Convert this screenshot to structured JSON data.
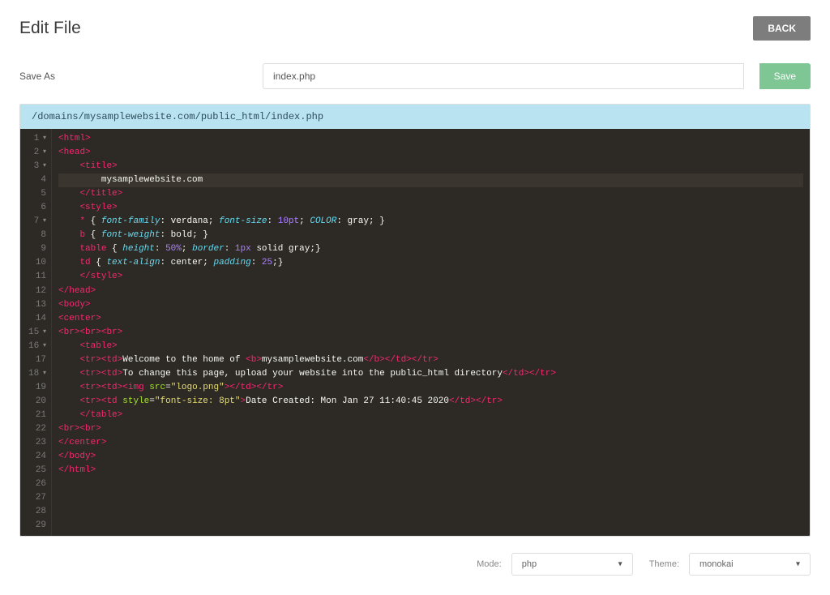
{
  "header": {
    "title": "Edit File",
    "back_label": "BACK"
  },
  "save": {
    "label": "Save As",
    "filename": "index.php",
    "save_label": "Save"
  },
  "path": "/domains/mysamplewebsite.com/public_html/index.php",
  "code_lines": [
    {
      "n": 1,
      "fold": true,
      "segs": [
        [
          "<",
          "t-tag"
        ],
        [
          "html",
          "t-tag"
        ],
        [
          ">",
          "t-tag"
        ]
      ]
    },
    {
      "n": 2,
      "fold": true,
      "segs": [
        [
          "<",
          "t-tag"
        ],
        [
          "head",
          "t-tag"
        ],
        [
          ">",
          "t-tag"
        ]
      ]
    },
    {
      "n": 3,
      "fold": true,
      "segs": [
        [
          "    ",
          "t-text"
        ],
        [
          "<",
          "t-tag"
        ],
        [
          "title",
          "t-tag"
        ],
        [
          ">",
          "t-tag"
        ]
      ]
    },
    {
      "n": 4,
      "active": true,
      "segs": [
        [
          "        mysamplewebsite.com",
          "t-text"
        ]
      ]
    },
    {
      "n": 5,
      "segs": [
        [
          "    ",
          "t-text"
        ],
        [
          "</",
          "t-tag"
        ],
        [
          "title",
          "t-tag"
        ],
        [
          ">",
          "t-tag"
        ]
      ]
    },
    {
      "n": 6,
      "segs": [
        [
          "",
          "t-text"
        ]
      ]
    },
    {
      "n": 7,
      "fold": true,
      "segs": [
        [
          "    ",
          "t-text"
        ],
        [
          "<",
          "t-tag"
        ],
        [
          "style",
          "t-tag"
        ],
        [
          ">",
          "t-tag"
        ]
      ]
    },
    {
      "n": 8,
      "segs": [
        [
          "    ",
          "t-text"
        ],
        [
          "*",
          "t-sel"
        ],
        [
          " { ",
          "t-brace"
        ],
        [
          "font-family",
          "t-kw"
        ],
        [
          ": verdana; ",
          "t-text"
        ],
        [
          "font-size",
          "t-kw"
        ],
        [
          ": ",
          "t-text"
        ],
        [
          "10pt",
          "t-num"
        ],
        [
          "; ",
          "t-text"
        ],
        [
          "COLOR",
          "t-kw"
        ],
        [
          ": gray; ",
          "t-text"
        ],
        [
          "}",
          "t-brace"
        ]
      ]
    },
    {
      "n": 9,
      "segs": [
        [
          "    ",
          "t-text"
        ],
        [
          "b",
          "t-sel"
        ],
        [
          " { ",
          "t-brace"
        ],
        [
          "font-weight",
          "t-kw"
        ],
        [
          ": bold; ",
          "t-text"
        ],
        [
          "}",
          "t-brace"
        ]
      ]
    },
    {
      "n": 10,
      "segs": [
        [
          "    ",
          "t-text"
        ],
        [
          "table",
          "t-sel"
        ],
        [
          " { ",
          "t-brace"
        ],
        [
          "height",
          "t-kw"
        ],
        [
          ": ",
          "t-text"
        ],
        [
          "50%",
          "t-num"
        ],
        [
          "; ",
          "t-text"
        ],
        [
          "border",
          "t-kw"
        ],
        [
          ": ",
          "t-text"
        ],
        [
          "1px",
          "t-num"
        ],
        [
          " solid gray;",
          "t-text"
        ],
        [
          "}",
          "t-brace"
        ]
      ]
    },
    {
      "n": 11,
      "segs": [
        [
          "    ",
          "t-text"
        ],
        [
          "td",
          "t-sel"
        ],
        [
          " { ",
          "t-brace"
        ],
        [
          "text-align",
          "t-kw"
        ],
        [
          ": center; ",
          "t-text"
        ],
        [
          "padding",
          "t-kw"
        ],
        [
          ": ",
          "t-text"
        ],
        [
          "25",
          "t-num"
        ],
        [
          ";",
          "t-text"
        ],
        [
          "}",
          "t-brace"
        ]
      ]
    },
    {
      "n": 12,
      "segs": [
        [
          "",
          "t-text"
        ]
      ]
    },
    {
      "n": 13,
      "segs": [
        [
          "    ",
          "t-text"
        ],
        [
          "</",
          "t-tag"
        ],
        [
          "style",
          "t-tag"
        ],
        [
          ">",
          "t-tag"
        ]
      ]
    },
    {
      "n": 14,
      "segs": [
        [
          "</",
          "t-tag"
        ],
        [
          "head",
          "t-tag"
        ],
        [
          ">",
          "t-tag"
        ]
      ]
    },
    {
      "n": 15,
      "fold": true,
      "segs": [
        [
          "<",
          "t-tag"
        ],
        [
          "body",
          "t-tag"
        ],
        [
          ">",
          "t-tag"
        ]
      ]
    },
    {
      "n": 16,
      "fold": true,
      "segs": [
        [
          "<",
          "t-tag"
        ],
        [
          "center",
          "t-tag"
        ],
        [
          ">",
          "t-tag"
        ]
      ]
    },
    {
      "n": 17,
      "segs": [
        [
          "<",
          "t-tag"
        ],
        [
          "br",
          "t-tag"
        ],
        [
          "><",
          "t-tag"
        ],
        [
          "br",
          "t-tag"
        ],
        [
          "><",
          "t-tag"
        ],
        [
          "br",
          "t-tag"
        ],
        [
          ">",
          "t-tag"
        ]
      ]
    },
    {
      "n": 18,
      "fold": true,
      "segs": [
        [
          "    ",
          "t-text"
        ],
        [
          "<",
          "t-tag"
        ],
        [
          "table",
          "t-tag"
        ],
        [
          ">",
          "t-tag"
        ]
      ]
    },
    {
      "n": 19,
      "segs": [
        [
          "    ",
          "t-text"
        ],
        [
          "<",
          "t-tag"
        ],
        [
          "tr",
          "t-tag"
        ],
        [
          "><",
          "t-tag"
        ],
        [
          "td",
          "t-tag"
        ],
        [
          ">",
          "t-tag"
        ],
        [
          "Welcome to the home of ",
          "t-text"
        ],
        [
          "<",
          "t-tag"
        ],
        [
          "b",
          "t-tag"
        ],
        [
          ">",
          "t-tag"
        ],
        [
          "mysamplewebsite.com",
          "t-text"
        ],
        [
          "</",
          "t-tag"
        ],
        [
          "b",
          "t-tag"
        ],
        [
          "></",
          "t-tag"
        ],
        [
          "td",
          "t-tag"
        ],
        [
          "></",
          "t-tag"
        ],
        [
          "tr",
          "t-tag"
        ],
        [
          ">",
          "t-tag"
        ]
      ]
    },
    {
      "n": 20,
      "segs": [
        [
          "    ",
          "t-text"
        ],
        [
          "<",
          "t-tag"
        ],
        [
          "tr",
          "t-tag"
        ],
        [
          "><",
          "t-tag"
        ],
        [
          "td",
          "t-tag"
        ],
        [
          ">",
          "t-tag"
        ],
        [
          "To change this page, upload your website into the public_html directory",
          "t-text"
        ],
        [
          "</",
          "t-tag"
        ],
        [
          "td",
          "t-tag"
        ],
        [
          "></",
          "t-tag"
        ],
        [
          "tr",
          "t-tag"
        ],
        [
          ">",
          "t-tag"
        ]
      ]
    },
    {
      "n": 21,
      "segs": [
        [
          "    ",
          "t-text"
        ],
        [
          "<",
          "t-tag"
        ],
        [
          "tr",
          "t-tag"
        ],
        [
          "><",
          "t-tag"
        ],
        [
          "td",
          "t-tag"
        ],
        [
          "><",
          "t-tag"
        ],
        [
          "img",
          "t-tag"
        ],
        [
          " ",
          "t-text"
        ],
        [
          "src",
          "t-attr"
        ],
        [
          "=",
          "t-text"
        ],
        [
          "\"logo.png\"",
          "t-str"
        ],
        [
          "></",
          "t-tag"
        ],
        [
          "td",
          "t-tag"
        ],
        [
          "></",
          "t-tag"
        ],
        [
          "tr",
          "t-tag"
        ],
        [
          ">",
          "t-tag"
        ]
      ]
    },
    {
      "n": 22,
      "segs": [
        [
          "    ",
          "t-text"
        ],
        [
          "<",
          "t-tag"
        ],
        [
          "tr",
          "t-tag"
        ],
        [
          "><",
          "t-tag"
        ],
        [
          "td",
          "t-tag"
        ],
        [
          " ",
          "t-text"
        ],
        [
          "style",
          "t-attr"
        ],
        [
          "=",
          "t-text"
        ],
        [
          "\"font-size: 8pt\"",
          "t-str"
        ],
        [
          ">",
          "t-tag"
        ],
        [
          "Date Created: Mon Jan 27 11:40:45 2020",
          "t-text"
        ],
        [
          "</",
          "t-tag"
        ],
        [
          "td",
          "t-tag"
        ],
        [
          "></",
          "t-tag"
        ],
        [
          "tr",
          "t-tag"
        ],
        [
          ">",
          "t-tag"
        ]
      ]
    },
    {
      "n": 23,
      "segs": [
        [
          "    ",
          "t-text"
        ],
        [
          "</",
          "t-tag"
        ],
        [
          "table",
          "t-tag"
        ],
        [
          ">",
          "t-tag"
        ]
      ]
    },
    {
      "n": 24,
      "segs": [
        [
          "<",
          "t-tag"
        ],
        [
          "br",
          "t-tag"
        ],
        [
          "><",
          "t-tag"
        ],
        [
          "br",
          "t-tag"
        ],
        [
          ">",
          "t-tag"
        ]
      ]
    },
    {
      "n": 25,
      "segs": [
        [
          "",
          "t-text"
        ]
      ]
    },
    {
      "n": 26,
      "segs": [
        [
          "</",
          "t-tag"
        ],
        [
          "center",
          "t-tag"
        ],
        [
          ">",
          "t-tag"
        ]
      ]
    },
    {
      "n": 27,
      "segs": [
        [
          "</",
          "t-tag"
        ],
        [
          "body",
          "t-tag"
        ],
        [
          ">",
          "t-tag"
        ]
      ]
    },
    {
      "n": 28,
      "segs": [
        [
          "",
          "t-text"
        ]
      ]
    },
    {
      "n": 29,
      "segs": [
        [
          "</",
          "t-tag"
        ],
        [
          "html",
          "t-tag"
        ],
        [
          ">",
          "t-tag"
        ]
      ]
    }
  ],
  "footer": {
    "mode_label": "Mode:",
    "mode_value": "php",
    "theme_label": "Theme:",
    "theme_value": "monokai"
  }
}
